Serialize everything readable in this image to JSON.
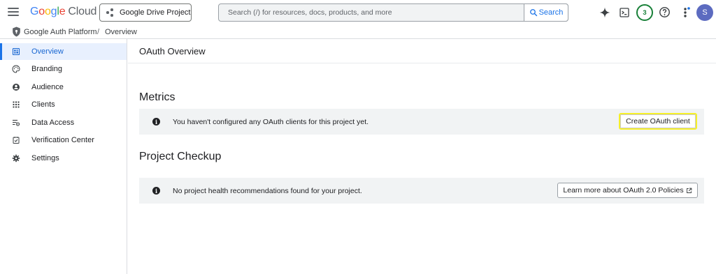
{
  "header": {
    "logo_letters": [
      "G",
      "o",
      "o",
      "g",
      "l",
      "e"
    ],
    "logo_product": "Cloud",
    "project_label": "Google Drive Project",
    "search_placeholder": "Search (/) for resources, docs, products, and more",
    "search_button": "Search",
    "notification_count": "3",
    "avatar_initial": "S"
  },
  "breadcrumb": {
    "items": [
      "Google Auth Platform",
      "Overview"
    ],
    "separator": "/"
  },
  "sidebar": {
    "items": [
      {
        "label": "Overview",
        "icon": "dashboard-icon",
        "active": true
      },
      {
        "label": "Branding",
        "icon": "palette-icon",
        "active": false
      },
      {
        "label": "Audience",
        "icon": "account-circle-icon",
        "active": false
      },
      {
        "label": "Clients",
        "icon": "grid-apps-icon",
        "active": false
      },
      {
        "label": "Data Access",
        "icon": "data-access-icon",
        "active": false
      },
      {
        "label": "Verification Center",
        "icon": "verified-checkbox-icon",
        "active": false
      },
      {
        "label": "Settings",
        "icon": "gear-icon",
        "active": false
      }
    ]
  },
  "main": {
    "title": "OAuth Overview",
    "metrics": {
      "heading": "Metrics",
      "message": "You haven't configured any OAuth clients for this project yet.",
      "button": "Create OAuth client"
    },
    "checkup": {
      "heading": "Project Checkup",
      "message": "No project health recommendations found for your project.",
      "button": "Learn more about OAuth 2.0 Policies"
    }
  },
  "colors": {
    "accent": "#1a73e8",
    "active_bg": "#e8f0fe",
    "info_bg": "#f1f3f4",
    "highlight": "#f6f02a",
    "badge": "#188038",
    "avatar": "#5c6bc0"
  }
}
